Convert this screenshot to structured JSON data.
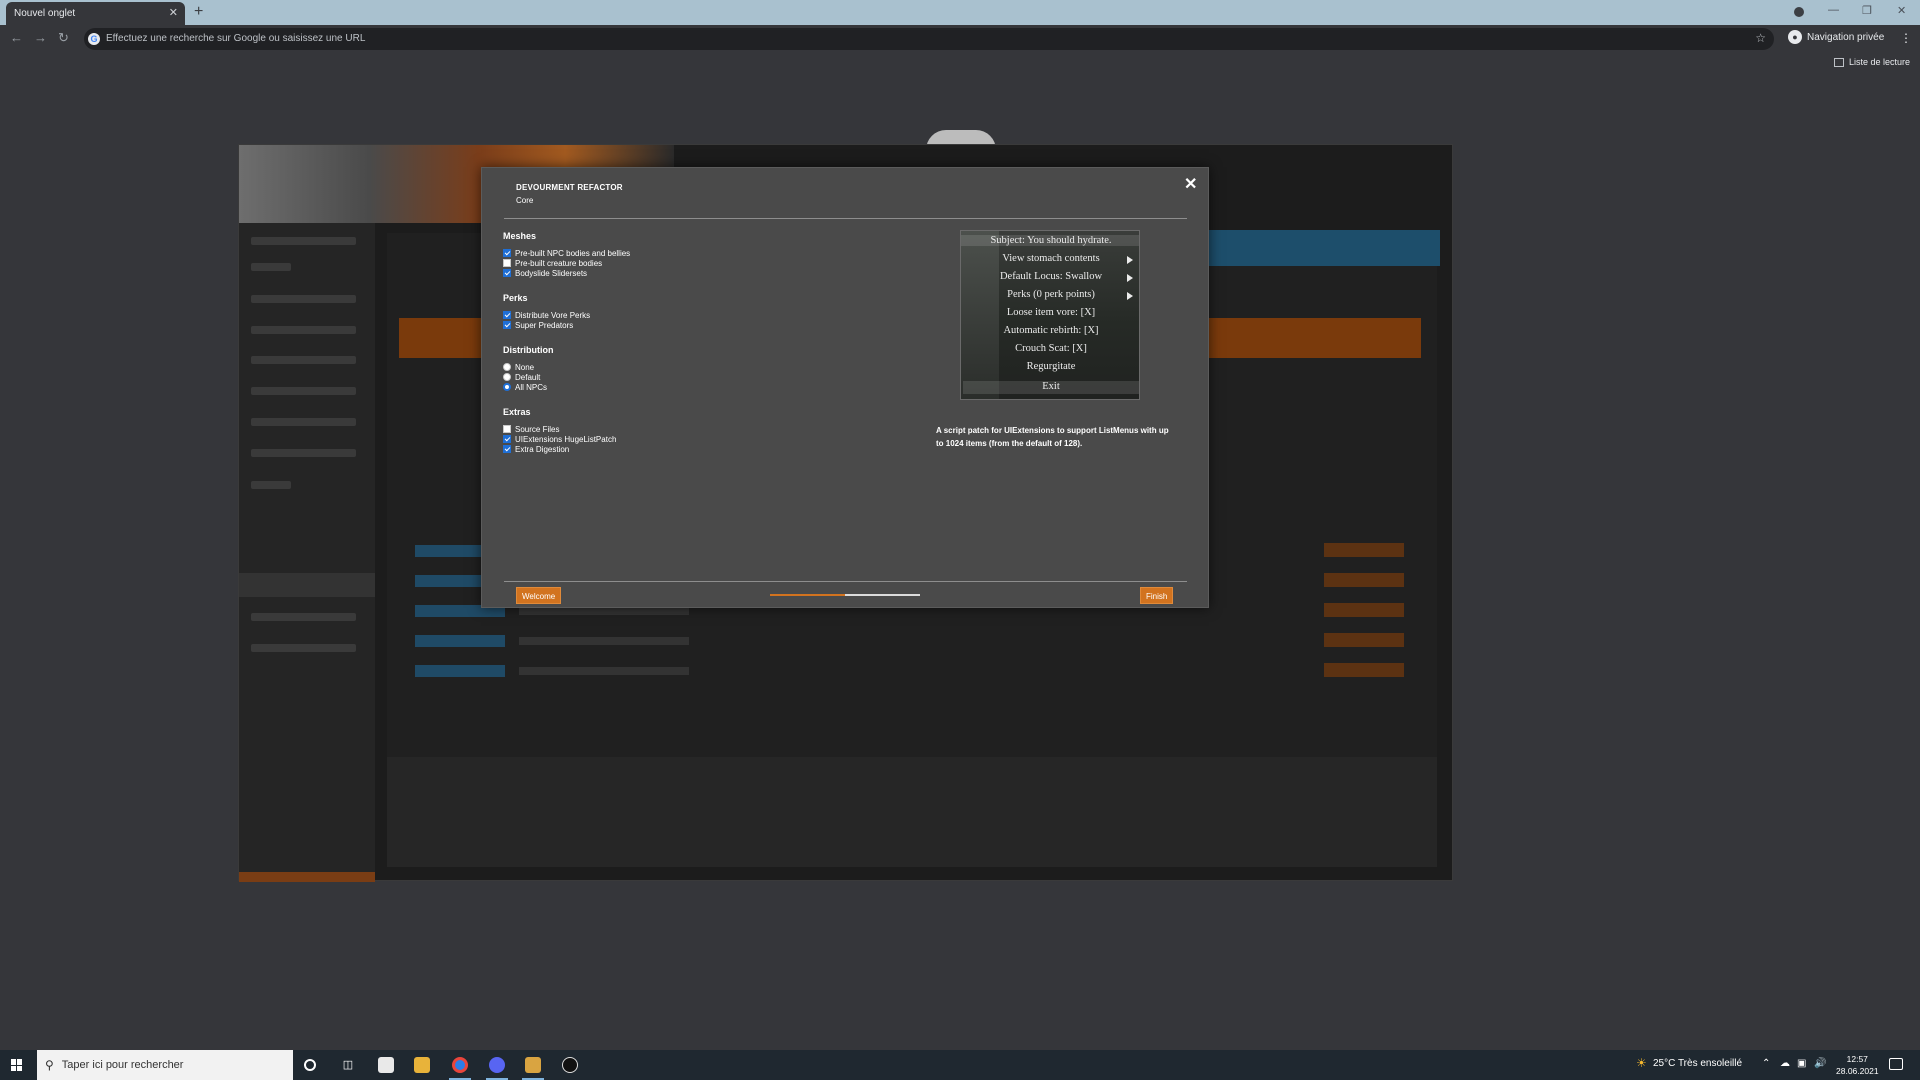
{
  "browser": {
    "tab_title": "Nouvel onglet",
    "tab_close": "✕",
    "new_tab": "+",
    "omnibox_placeholder": "Effectuez une recherche sur Google ou saisissez une URL",
    "private_label": "Navigation privée",
    "reading_list": "Liste de lecture"
  },
  "dialog": {
    "title": "DEVOURMENT REFACTOR",
    "subtitle": "Core",
    "close": "✕",
    "groups": [
      {
        "title": "Meshes",
        "type": "checkbox",
        "options": [
          {
            "label": "Pre-built NPC bodies and bellies",
            "checked": true
          },
          {
            "label": "Pre-built creature bodies",
            "checked": false
          },
          {
            "label": "Bodyslide Slidersets",
            "checked": true
          }
        ]
      },
      {
        "title": "Perks",
        "type": "checkbox",
        "options": [
          {
            "label": "Distribute Vore Perks",
            "checked": true
          },
          {
            "label": "Super Predators",
            "checked": true
          }
        ]
      },
      {
        "title": "Distribution",
        "type": "radio",
        "options": [
          {
            "label": "None",
            "checked": false
          },
          {
            "label": "Default",
            "checked": false
          },
          {
            "label": "All NPCs",
            "checked": true
          }
        ]
      },
      {
        "title": "Extras",
        "type": "checkbox",
        "options": [
          {
            "label": "Source Files",
            "checked": false
          },
          {
            "label": "UIExtensions HugeListPatch",
            "checked": true
          },
          {
            "label": "Extra Digestion",
            "checked": true
          }
        ]
      }
    ],
    "preview_lines": [
      "Subject: You should hydrate.",
      "View stomach contents",
      "Default Locus: Swallow",
      "Perks (0 perk points)",
      "Loose item vore: [X]",
      "Automatic rebirth: [X]",
      "Crouch Scat: [X]",
      "Regurgitate",
      "Exit"
    ],
    "description": "A script patch for UIExtensions to support ListMenus with up to 1024 items (from the default of 128).",
    "back_button": "Welcome",
    "finish_button": "Finish",
    "progress_fraction": 0.5
  },
  "taskbar": {
    "search_placeholder": "Taper ici pour rechercher",
    "weather": "25°C  Très ensoleillé",
    "time": "12:57",
    "date": "28.06.2021"
  }
}
